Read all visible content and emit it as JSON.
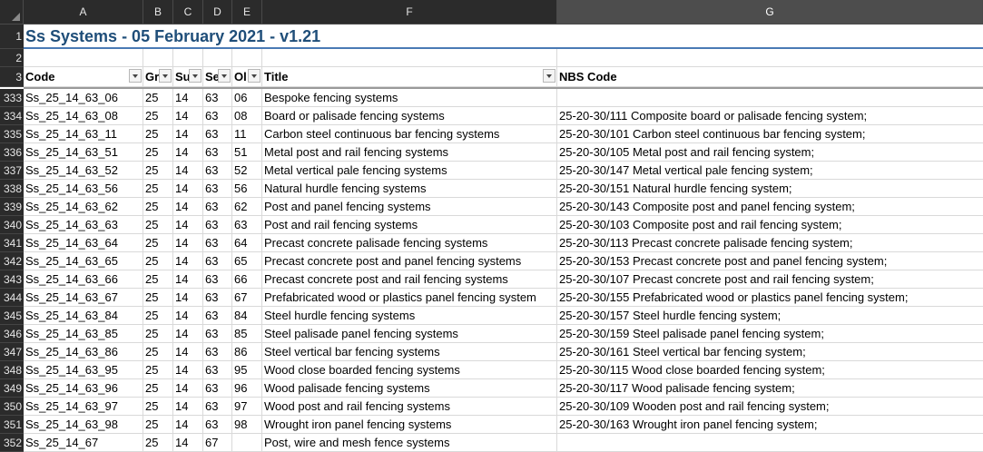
{
  "columns": [
    "A",
    "B",
    "C",
    "D",
    "E",
    "F",
    "G"
  ],
  "selected_column": "G",
  "title": "Ss Systems - 05 February 2021 - v1.21",
  "row_numbers_top": [
    "1",
    "2",
    "3"
  ],
  "headers": [
    "Code",
    "Gr",
    "Su",
    "Se",
    "Ol",
    "Title",
    "NBS Code"
  ],
  "rows": [
    {
      "n": "333",
      "code": "Ss_25_14_63_06",
      "gr": "25",
      "su": "14",
      "se": "63",
      "ob": "06",
      "title": "Bespoke fencing systems",
      "nbs": ""
    },
    {
      "n": "334",
      "code": "Ss_25_14_63_08",
      "gr": "25",
      "su": "14",
      "se": "63",
      "ob": "08",
      "title": "Board or palisade fencing systems",
      "nbs": "25-20-30/111 Composite board or palisade fencing system;"
    },
    {
      "n": "335",
      "code": "Ss_25_14_63_11",
      "gr": "25",
      "su": "14",
      "se": "63",
      "ob": "11",
      "title": "Carbon steel continuous bar fencing systems",
      "nbs": "25-20-30/101 Carbon steel continuous bar fencing system;"
    },
    {
      "n": "336",
      "code": "Ss_25_14_63_51",
      "gr": "25",
      "su": "14",
      "se": "63",
      "ob": "51",
      "title": "Metal post and rail fencing systems",
      "nbs": "25-20-30/105 Metal post and rail fencing system;"
    },
    {
      "n": "337",
      "code": "Ss_25_14_63_52",
      "gr": "25",
      "su": "14",
      "se": "63",
      "ob": "52",
      "title": "Metal vertical pale fencing systems",
      "nbs": "25-20-30/147 Metal vertical pale fencing system;"
    },
    {
      "n": "338",
      "code": "Ss_25_14_63_56",
      "gr": "25",
      "su": "14",
      "se": "63",
      "ob": "56",
      "title": "Natural hurdle fencing systems",
      "nbs": "25-20-30/151 Natural hurdle fencing system;"
    },
    {
      "n": "339",
      "code": "Ss_25_14_63_62",
      "gr": "25",
      "su": "14",
      "se": "63",
      "ob": "62",
      "title": "Post and panel fencing systems",
      "nbs": "25-20-30/143 Composite post and panel fencing system;"
    },
    {
      "n": "340",
      "code": "Ss_25_14_63_63",
      "gr": "25",
      "su": "14",
      "se": "63",
      "ob": "63",
      "title": "Post and rail fencing systems",
      "nbs": "25-20-30/103 Composite post and rail fencing system;"
    },
    {
      "n": "341",
      "code": "Ss_25_14_63_64",
      "gr": "25",
      "su": "14",
      "se": "63",
      "ob": "64",
      "title": "Precast concrete palisade fencing systems",
      "nbs": "25-20-30/113 Precast concrete palisade fencing system;"
    },
    {
      "n": "342",
      "code": "Ss_25_14_63_65",
      "gr": "25",
      "su": "14",
      "se": "63",
      "ob": "65",
      "title": "Precast concrete post and panel fencing systems",
      "nbs": "25-20-30/153 Precast concrete post and panel fencing system;"
    },
    {
      "n": "343",
      "code": "Ss_25_14_63_66",
      "gr": "25",
      "su": "14",
      "se": "63",
      "ob": "66",
      "title": "Precast concrete post and rail fencing systems",
      "nbs": "25-20-30/107 Precast concrete post and rail fencing system;"
    },
    {
      "n": "344",
      "code": "Ss_25_14_63_67",
      "gr": "25",
      "su": "14",
      "se": "63",
      "ob": "67",
      "title": "Prefabricated wood or plastics panel fencing system",
      "nbs": "25-20-30/155 Prefabricated wood or plastics panel fencing system;"
    },
    {
      "n": "345",
      "code": "Ss_25_14_63_84",
      "gr": "25",
      "su": "14",
      "se": "63",
      "ob": "84",
      "title": "Steel hurdle fencing systems",
      "nbs": "25-20-30/157 Steel hurdle fencing system;"
    },
    {
      "n": "346",
      "code": "Ss_25_14_63_85",
      "gr": "25",
      "su": "14",
      "se": "63",
      "ob": "85",
      "title": "Steel palisade panel fencing systems",
      "nbs": "25-20-30/159 Steel palisade panel fencing system;"
    },
    {
      "n": "347",
      "code": "Ss_25_14_63_86",
      "gr": "25",
      "su": "14",
      "se": "63",
      "ob": "86",
      "title": "Steel vertical bar fencing systems",
      "nbs": "25-20-30/161 Steel vertical bar fencing system;"
    },
    {
      "n": "348",
      "code": "Ss_25_14_63_95",
      "gr": "25",
      "su": "14",
      "se": "63",
      "ob": "95",
      "title": "Wood close boarded fencing systems",
      "nbs": "25-20-30/115 Wood close boarded fencing system;"
    },
    {
      "n": "349",
      "code": "Ss_25_14_63_96",
      "gr": "25",
      "su": "14",
      "se": "63",
      "ob": "96",
      "title": "Wood palisade fencing systems",
      "nbs": "25-20-30/117 Wood palisade fencing system;"
    },
    {
      "n": "350",
      "code": "Ss_25_14_63_97",
      "gr": "25",
      "su": "14",
      "se": "63",
      "ob": "97",
      "title": "Wood post and rail fencing systems",
      "nbs": "25-20-30/109 Wooden post and rail fencing system;"
    },
    {
      "n": "351",
      "code": "Ss_25_14_63_98",
      "gr": "25",
      "su": "14",
      "se": "63",
      "ob": "98",
      "title": "Wrought iron panel fencing systems",
      "nbs": "25-20-30/163 Wrought iron panel fencing system;"
    },
    {
      "n": "352",
      "code": "Ss_25_14_67",
      "gr": "25",
      "su": "14",
      "se": "67",
      "ob": "",
      "title": "Post, wire and mesh fence systems",
      "nbs": ""
    }
  ],
  "colors": {
    "title": "#1f4e79",
    "header_bg": "#2b2b2b",
    "selected_header": "#4d4d4d",
    "title_rule": "#4a7ab5"
  }
}
